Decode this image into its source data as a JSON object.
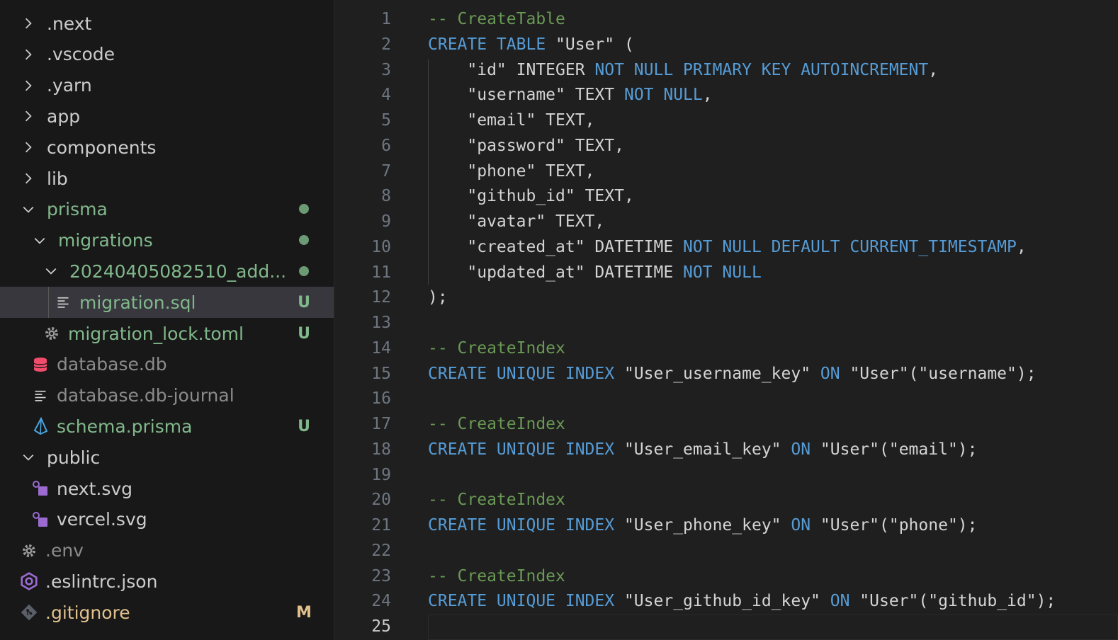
{
  "explorer": {
    "items": [
      {
        "label": ".next",
        "indent": 0,
        "kind": "folder-closed",
        "color": "white"
      },
      {
        "label": ".vscode",
        "indent": 0,
        "kind": "folder-closed",
        "color": "white"
      },
      {
        "label": ".yarn",
        "indent": 0,
        "kind": "folder-closed",
        "color": "white"
      },
      {
        "label": "app",
        "indent": 0,
        "kind": "folder-closed",
        "color": "white"
      },
      {
        "label": "components",
        "indent": 0,
        "kind": "folder-closed",
        "color": "white"
      },
      {
        "label": "lib",
        "indent": 0,
        "kind": "folder-closed",
        "color": "white"
      },
      {
        "label": "prisma",
        "indent": 0,
        "kind": "folder-open",
        "color": "green",
        "decoration": "dot"
      },
      {
        "label": "migrations",
        "indent": 1,
        "kind": "folder-open",
        "color": "green",
        "decoration": "dot"
      },
      {
        "label": "20240405082510_add...",
        "indent": 2,
        "kind": "folder-open",
        "color": "green",
        "decoration": "dot"
      },
      {
        "label": "migration.sql",
        "indent": 3,
        "kind": "file-lines",
        "color": "green",
        "decoration": "U",
        "selected": true
      },
      {
        "label": "migration_lock.toml",
        "indent": 2,
        "kind": "file-gear",
        "color": "green",
        "decoration": "U"
      },
      {
        "label": "database.db",
        "indent": 1,
        "kind": "file-db",
        "color": "muted"
      },
      {
        "label": "database.db-journal",
        "indent": 1,
        "kind": "file-lines",
        "color": "muted"
      },
      {
        "label": "schema.prisma",
        "indent": 1,
        "kind": "file-prisma",
        "color": "green",
        "decoration": "U"
      },
      {
        "label": "public",
        "indent": 0,
        "kind": "folder-open",
        "color": "white"
      },
      {
        "label": "next.svg",
        "indent": 1,
        "kind": "file-svg",
        "color": "white"
      },
      {
        "label": "vercel.svg",
        "indent": 1,
        "kind": "file-svg",
        "color": "white"
      },
      {
        "label": ".env",
        "indent": 0,
        "kind": "file-gear",
        "color": "muted"
      },
      {
        "label": ".eslintrc.json",
        "indent": 0,
        "kind": "file-eslint",
        "color": "white"
      },
      {
        "label": ".gitignore",
        "indent": 0,
        "kind": "file-git",
        "color": "yellow",
        "decoration": "M"
      }
    ]
  },
  "editor": {
    "active_line": 25,
    "lines": [
      [
        [
          "cm",
          "-- CreateTable"
        ]
      ],
      [
        [
          "kw",
          "CREATE TABLE "
        ],
        [
          "str",
          "\"User\""
        ],
        [
          "plain",
          " ("
        ]
      ],
      [
        [
          "plain",
          "    "
        ],
        [
          "str",
          "\"id\""
        ],
        [
          "plain",
          " INTEGER "
        ],
        [
          "kw",
          "NOT NULL PRIMARY KEY AUTOINCREMENT"
        ],
        [
          "plain",
          ","
        ]
      ],
      [
        [
          "plain",
          "    "
        ],
        [
          "str",
          "\"username\""
        ],
        [
          "plain",
          " TEXT "
        ],
        [
          "kw",
          "NOT NULL"
        ],
        [
          "plain",
          ","
        ]
      ],
      [
        [
          "plain",
          "    "
        ],
        [
          "str",
          "\"email\""
        ],
        [
          "plain",
          " TEXT,"
        ]
      ],
      [
        [
          "plain",
          "    "
        ],
        [
          "str",
          "\"password\""
        ],
        [
          "plain",
          " TEXT,"
        ]
      ],
      [
        [
          "plain",
          "    "
        ],
        [
          "str",
          "\"phone\""
        ],
        [
          "plain",
          " TEXT,"
        ]
      ],
      [
        [
          "plain",
          "    "
        ],
        [
          "str",
          "\"github_id\""
        ],
        [
          "plain",
          " TEXT,"
        ]
      ],
      [
        [
          "plain",
          "    "
        ],
        [
          "str",
          "\"avatar\""
        ],
        [
          "plain",
          " TEXT,"
        ]
      ],
      [
        [
          "plain",
          "    "
        ],
        [
          "str",
          "\"created_at\""
        ],
        [
          "plain",
          " DATETIME "
        ],
        [
          "kw",
          "NOT NULL DEFAULT CURRENT_TIMESTAMP"
        ],
        [
          "plain",
          ","
        ]
      ],
      [
        [
          "plain",
          "    "
        ],
        [
          "str",
          "\"updated_at\""
        ],
        [
          "plain",
          " DATETIME "
        ],
        [
          "kw",
          "NOT NULL"
        ]
      ],
      [
        [
          "plain",
          ");"
        ]
      ],
      [],
      [
        [
          "cm",
          "-- CreateIndex"
        ]
      ],
      [
        [
          "kw",
          "CREATE UNIQUE INDEX "
        ],
        [
          "str",
          "\"User_username_key\""
        ],
        [
          "kw",
          " ON "
        ],
        [
          "str",
          "\"User\""
        ],
        [
          "plain",
          "("
        ],
        [
          "str",
          "\"username\""
        ],
        [
          "plain",
          ");"
        ]
      ],
      [],
      [
        [
          "cm",
          "-- CreateIndex"
        ]
      ],
      [
        [
          "kw",
          "CREATE UNIQUE INDEX "
        ],
        [
          "str",
          "\"User_email_key\""
        ],
        [
          "kw",
          " ON "
        ],
        [
          "str",
          "\"User\""
        ],
        [
          "plain",
          "("
        ],
        [
          "str",
          "\"email\""
        ],
        [
          "plain",
          ");"
        ]
      ],
      [],
      [
        [
          "cm",
          "-- CreateIndex"
        ]
      ],
      [
        [
          "kw",
          "CREATE UNIQUE INDEX "
        ],
        [
          "str",
          "\"User_phone_key\""
        ],
        [
          "kw",
          " ON "
        ],
        [
          "str",
          "\"User\""
        ],
        [
          "plain",
          "("
        ],
        [
          "str",
          "\"phone\""
        ],
        [
          "plain",
          ");"
        ]
      ],
      [],
      [
        [
          "cm",
          "-- CreateIndex"
        ]
      ],
      [
        [
          "kw",
          "CREATE UNIQUE INDEX "
        ],
        [
          "str",
          "\"User_github_id_key\""
        ],
        [
          "kw",
          " ON "
        ],
        [
          "str",
          "\"User\""
        ],
        [
          "plain",
          "("
        ],
        [
          "str",
          "\"github_id\""
        ],
        [
          "plain",
          ");"
        ]
      ],
      []
    ]
  },
  "colors": {
    "keyword": "#569cd6",
    "comment": "#6a9955",
    "git_untracked": "#81b88b",
    "git_modified": "#e2c08d",
    "selection": "#37373d"
  }
}
